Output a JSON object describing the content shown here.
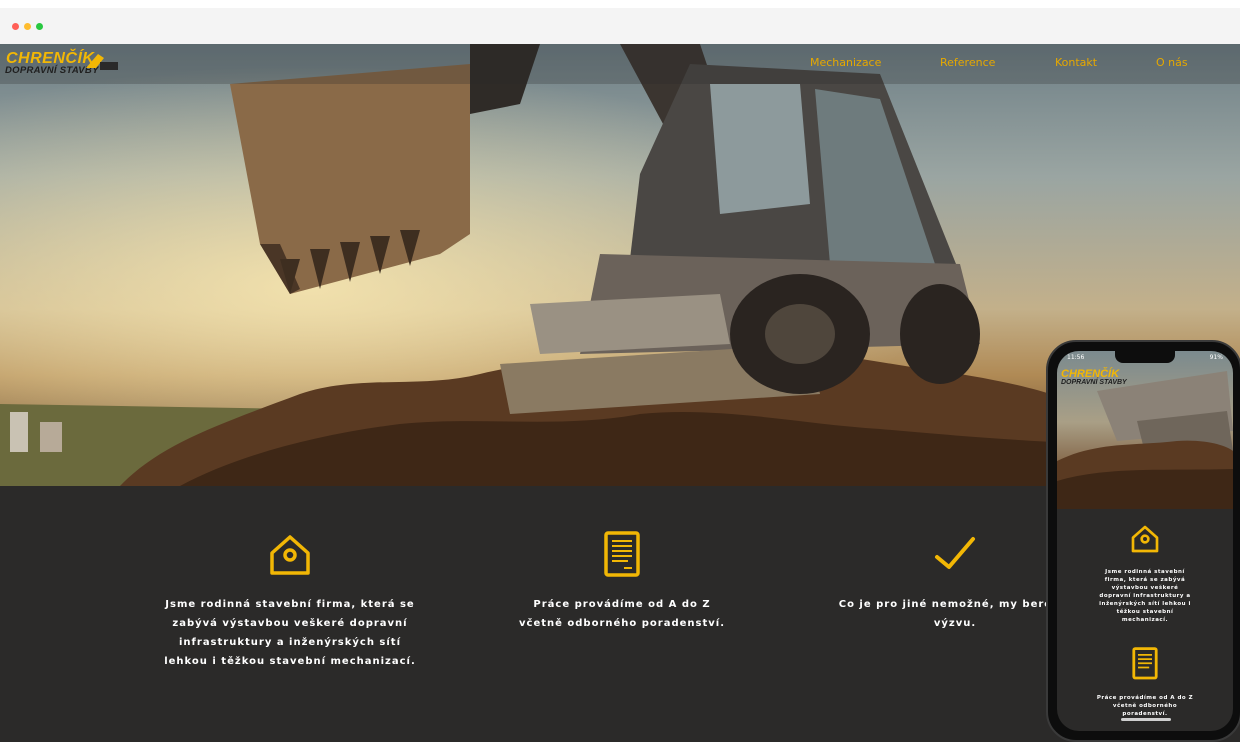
{
  "logo": {
    "top": "CHRENČÍK",
    "bottom": "DOPRAVNÍ STAVBY"
  },
  "nav": {
    "items": [
      "Mechanizace",
      "Reference",
      "Kontakt",
      "O nás"
    ]
  },
  "features": [
    {
      "icon": "home-icon",
      "text": "Jsme rodinná stavební firma, která se zabývá výstavbou veškeré dopravní infrastruktury a inženýrských sítí lehkou i těžkou stavební mechanizací."
    },
    {
      "icon": "document-icon",
      "text": "Práce provádíme od A do Z včetně odborného poradenství."
    },
    {
      "icon": "checkmark-icon",
      "text": "Co je pro jiné nemožné, my bereme výzvu."
    }
  ],
  "phone": {
    "time": "11:56",
    "battery": "91%",
    "logo_top": "CHRENČÍK",
    "logo_bottom": "DOPRAVNÍ STAVBY",
    "feature_1": "Jsme rodinná stavební firma, která se zabývá výstavbou veškeré dopravní infrastruktury a inženýrských sítí lehkou i těžkou stavební mechanizací.",
    "feature_2": "Práce provádíme od A do Z včetně odborného poradenství."
  },
  "colors": {
    "accent": "#f2b705",
    "dark": "#2b2a29"
  }
}
